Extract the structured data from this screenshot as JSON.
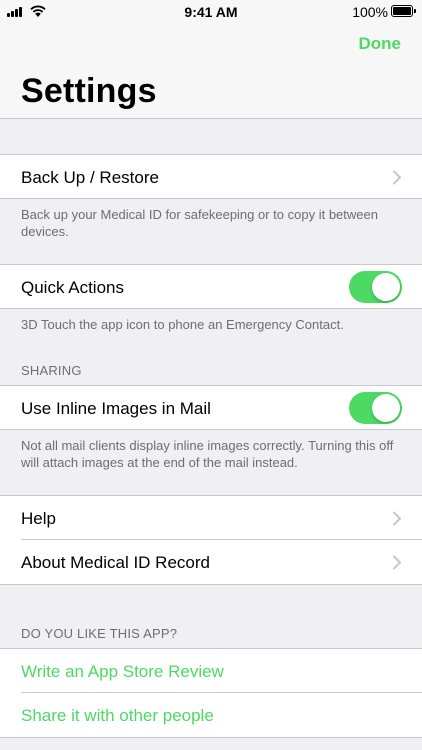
{
  "status": {
    "time": "9:41 AM",
    "battery_pct": "100%"
  },
  "nav": {
    "done_label": "Done",
    "title": "Settings"
  },
  "colors": {
    "accent_green": "#4cd964",
    "background": "#efeff4",
    "footnote_gray": "#6d6d72"
  },
  "backup": {
    "label": "Back Up / Restore",
    "footnote": "Back up your Medical ID for safekeeping or to copy it between devices."
  },
  "quick_actions": {
    "label": "Quick Actions",
    "enabled": true,
    "footnote": "3D Touch the app icon to phone an Emergency Contact."
  },
  "sharing": {
    "header": "SHARING",
    "inline_images_label": "Use Inline Images in Mail",
    "inline_images_enabled": true,
    "footnote": "Not all mail clients display inline images correctly. Turning this off will attach images at the end of the mail instead."
  },
  "info": {
    "help_label": "Help",
    "about_label": "About Medical ID Record"
  },
  "feedback": {
    "header": "DO YOU LIKE THIS APP?",
    "review_label": "Write an App Store Review",
    "share_label": "Share it with other people"
  },
  "icons": [
    "cellular-signal-icon",
    "wifi-icon",
    "battery-icon",
    "chevron-right-icon"
  ]
}
